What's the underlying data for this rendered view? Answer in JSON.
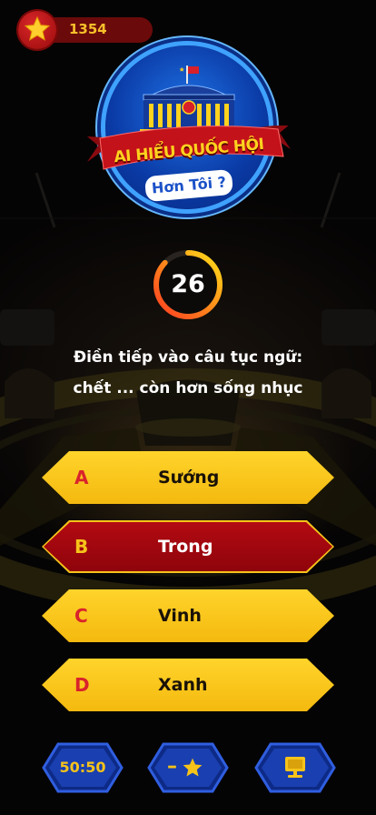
{
  "score": {
    "value": "1354",
    "icon": "star-icon"
  },
  "logo": {
    "line1": "AI HIỂU QUỐC HỘI",
    "line2": "Hơn Tôi ?"
  },
  "timer": {
    "value": "26",
    "remaining_fraction": 0.87
  },
  "question": {
    "line1": "Điền tiếp vào câu tục ngữ:",
    "line2": "chết ... còn hơn sống nhục"
  },
  "answers": [
    {
      "letter": "A",
      "text": "Sướng",
      "state": "default"
    },
    {
      "letter": "B",
      "text": "Trong",
      "state": "selected"
    },
    {
      "letter": "C",
      "text": "Vinh",
      "state": "default"
    },
    {
      "letter": "D",
      "text": "Xanh",
      "state": "default"
    }
  ],
  "lifelines": {
    "fifty_fifty": {
      "label": "50:50"
    },
    "minus_star": {
      "label": "–",
      "icon": "star-icon"
    },
    "screen": {
      "icon": "monitor-icon"
    }
  },
  "colors": {
    "answer_yellow": "#f6c31a",
    "answer_selected": "#a8070f",
    "letter_red": "#d9232b",
    "lifeline_blue": "#1a3fb0",
    "score_text": "#f7c02a"
  }
}
